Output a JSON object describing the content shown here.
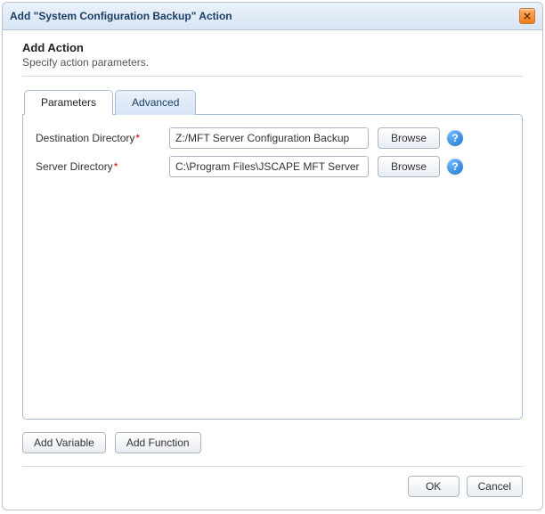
{
  "dialog": {
    "title": "Add \"System Configuration Backup\" Action"
  },
  "header": {
    "title": "Add Action",
    "subtitle": "Specify action parameters."
  },
  "tabs": {
    "parameters": "Parameters",
    "advanced": "Advanced"
  },
  "fields": {
    "destination": {
      "label": "Destination Directory",
      "value": "Z:/MFT Server Configuration Backup",
      "browse": "Browse"
    },
    "server": {
      "label": "Server Directory",
      "value": "C:\\Program Files\\JSCAPE MFT Server",
      "browse": "Browse"
    }
  },
  "footer": {
    "add_variable": "Add Variable",
    "add_function": "Add Function",
    "ok": "OK",
    "cancel": "Cancel"
  },
  "glyphs": {
    "help": "?"
  }
}
